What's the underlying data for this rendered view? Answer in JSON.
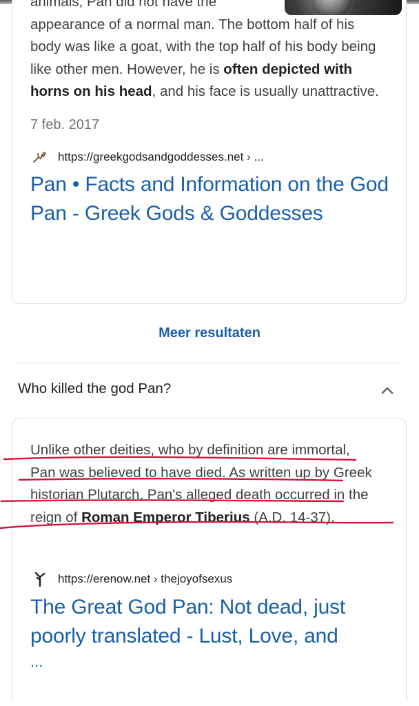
{
  "result1": {
    "snippet_line0": "animals, Pan did not have the",
    "snippet_rest": "appearance of a normal man. The bottom half of his body was like a goat, with the top half of his body being like other men. However, he is ",
    "snippet_bold": "often depicted with horns on his head",
    "snippet_end": ", and his face is usually unattractive.",
    "date": "7 feb. 2017",
    "source": "https://greekgodsandgoddesses.net › ...",
    "title": "Pan • Facts and Information on the God Pan - Greek Gods & Goddesses",
    "icon": "goat-horn-icon"
  },
  "more_results": "Meer resultaten",
  "question": "Who killed the god Pan?",
  "question_icon": "chevron-up-icon",
  "result2": {
    "snippet_start": "Unlike other deities, who by definition are immortal, Pan was believed to have died. As written up by Greek historian Plutarch, Pan's alleged death occurred in the reign of ",
    "snippet_bold": "Roman Emperor Tiberius",
    "snippet_end": " (A.D. 14-37).",
    "source": "https://erenow.net › thejoyofsexus",
    "title": "The Great God Pan: Not dead, just poorly translated - Lust, Love, and",
    "ellipsis": "...",
    "icon": "erenow-icon"
  },
  "colors": {
    "link": "#1a5fa8",
    "text": "#3c4043",
    "annotation": "#d6163c",
    "border": "#dadce0"
  }
}
